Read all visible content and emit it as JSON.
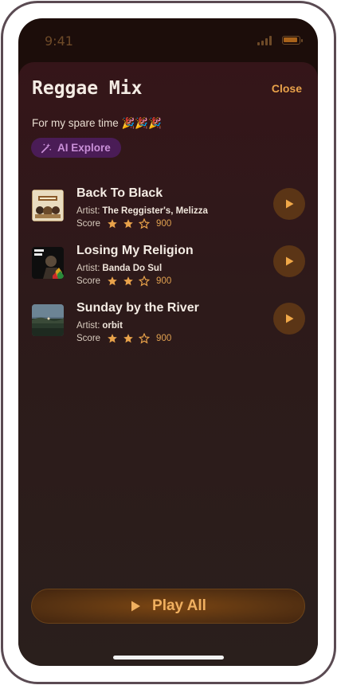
{
  "status_bar": {
    "time": "9:41"
  },
  "sheet": {
    "title": "Reggae Mix",
    "close_label": "Close",
    "subtitle": "For my spare time 🎉🎉🎉",
    "ai_badge_label": "AI Explore"
  },
  "labels": {
    "artist": "Artist:",
    "score": "Score"
  },
  "tracks": [
    {
      "title": "Back To Black",
      "artist": "The Reggister's, Melizza",
      "rating": 2,
      "max_rating": 3,
      "score": "900"
    },
    {
      "title": "Losing My Religion",
      "artist": "Banda Do Sul",
      "rating": 2,
      "max_rating": 3,
      "score": "900"
    },
    {
      "title": "Sunday by the River",
      "artist": "orbit",
      "rating": 2,
      "max_rating": 3,
      "score": "900"
    }
  ],
  "footer": {
    "play_all_label": "Play All"
  },
  "colors": {
    "accent": "#e9a24a",
    "background": "#1c0d0a",
    "badge": "#4a1c56"
  },
  "icons": {
    "status": [
      "signal-icon",
      "battery-icon"
    ],
    "badge": "magic-wand-icon",
    "track_action": "play-icon",
    "rating": [
      "star-filled-icon",
      "star-outline-icon"
    ]
  }
}
